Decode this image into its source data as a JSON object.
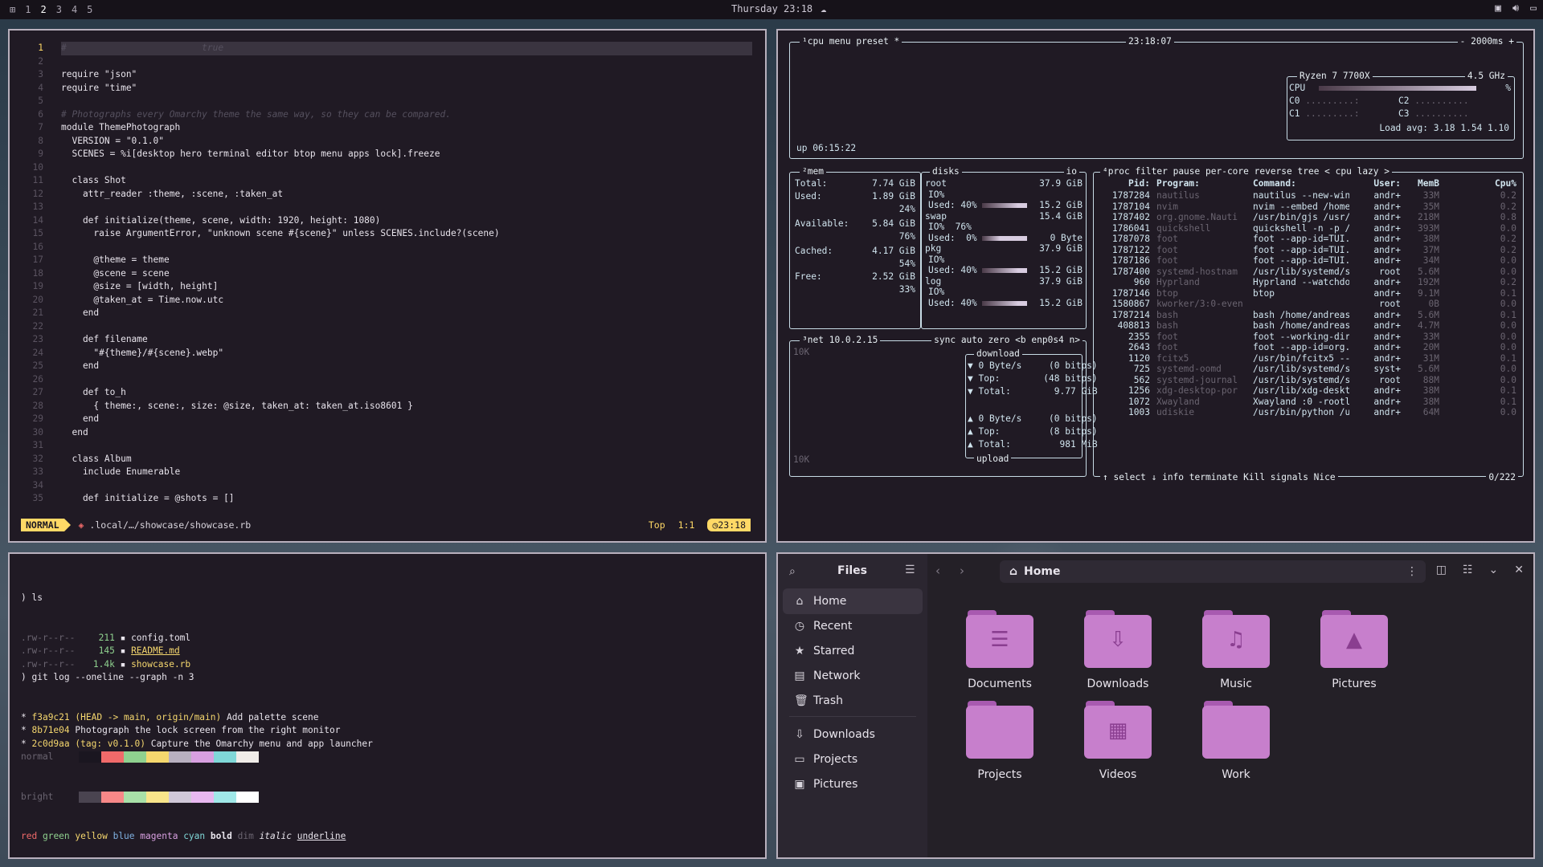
{
  "topbar": {
    "workspaces": [
      "1",
      "2",
      "3",
      "4",
      "5"
    ],
    "active_workspace": "2",
    "clock": "Thursday 23:18",
    "weather_icon": "cloud-icon",
    "tray": [
      "screen-icon",
      "volume-icon",
      "display-icon"
    ]
  },
  "editor": {
    "line_numbers": [
      "1",
      "2",
      "3",
      "4",
      "5",
      "6",
      "7",
      "8",
      "9",
      "10",
      "11",
      "12",
      "13",
      "14",
      "15",
      "16",
      "17",
      "18",
      "19",
      "20",
      "21",
      "22",
      "23",
      "24",
      "25",
      "26",
      "27",
      "28",
      "29",
      "30",
      "31",
      "32",
      "33",
      "34",
      "35"
    ],
    "lines": [
      "#                         true",
      "",
      "require \"json\"",
      "require \"time\"",
      "",
      "# Photographs every Omarchy theme the same way, so they can be compared.",
      "module ThemePhotograph",
      "  VERSION = \"0.1.0\"",
      "  SCENES = %i[desktop hero terminal editor btop menu apps lock].freeze",
      "",
      "  class Shot",
      "    attr_reader :theme, :scene, :taken_at",
      "",
      "    def initialize(theme, scene, width: 1920, height: 1080)",
      "      raise ArgumentError, \"unknown scene #{scene}\" unless SCENES.include?(scene)",
      "",
      "      @theme = theme",
      "      @scene = scene",
      "      @size = [width, height]",
      "      @taken_at = Time.now.utc",
      "    end",
      "",
      "    def filename",
      "      \"#{theme}/#{scene}.webp\"",
      "    end",
      "",
      "    def to_h",
      "      { theme:, scene:, size: @size, taken_at: taken_at.iso8601 }",
      "    end",
      "  end",
      "",
      "  class Album",
      "    include Enumerable",
      "",
      "    def initialize = @shots = []"
    ],
    "mode": "NORMAL",
    "file": ".local/…/showcase/showcase.rb",
    "position_label": "Top",
    "cursor": "1:1",
    "time": "23:18"
  },
  "btop": {
    "cpu_title": "¹cpu",
    "menu": "menu",
    "preset": "preset *",
    "time": "23:18:07",
    "interval": "- 2000ms +",
    "cpu_model": "Ryzen 7 7700X",
    "cpu_freq": "4.5 GHz",
    "cpu_label": "CPU",
    "cores": [
      "C0",
      "C1",
      "C2",
      "C3"
    ],
    "pct": "%",
    "load_avg": "Load avg: 3.18 1.54 1.10",
    "uptime": "up 06:15:22",
    "mem": {
      "title": "²mem",
      "total_label": "Total:",
      "total": "7.74 GiB",
      "used_label": "Used:",
      "used": "1.89 GiB",
      "used_pct": "24%",
      "avail_label": "Available:",
      "avail": "5.84 GiB",
      "avail_pct": "76%",
      "cached_label": "Cached:",
      "cached": "4.17 GiB",
      "cached_pct": "54%",
      "free_label": "Free:",
      "free": "2.52 GiB",
      "free_pct": "33%"
    },
    "disks": {
      "title": "disks",
      "io": "io",
      "rows": [
        {
          "name": "root",
          "size": "37.9 GiB",
          "io": "IO%",
          "used": "Used: 40%",
          "total": "15.2 GiB",
          "pct": 0.4
        },
        {
          "name": "swap",
          "size": "15.4 GiB",
          "io": "IO%  76%",
          "used": "Used:  0%",
          "total": "0 Byte",
          "pct": 0.0
        },
        {
          "name": "pkg",
          "size": "37.9 GiB",
          "io": "IO%",
          "used": "Used: 40%",
          "total": "15.2 GiB",
          "pct": 0.4
        },
        {
          "name": "log",
          "size": "37.9 GiB",
          "io": "IO%",
          "used": "Used: 40%",
          "total": "15.2 GiB",
          "pct": 0.4
        }
      ]
    },
    "net": {
      "title": "³net",
      "ip": "10.0.2.15",
      "opts": "sync auto zero <b enp0s4 n>",
      "scale_top": "10K",
      "scale_bottom": "10K",
      "download": "download",
      "upload": "upload",
      "down_rows": [
        "▼ 0 Byte/s     (0 bitps)",
        "▼ Top:        (48 bitps)",
        "▼ Total:        9.77 GiB"
      ],
      "up_rows": [
        "▲ 0 Byte/s     (0 bitps)",
        "▲ Top:         (8 bitps)",
        "▲ Total:         981 MiB"
      ]
    },
    "proc": {
      "title": "⁴proc",
      "tabs": "filter        pause per-core reverse tree < cpu lazy >",
      "header": [
        "Pid:",
        "Program:",
        "Command:",
        "User:",
        "MemB",
        "Cpu%"
      ],
      "rows": [
        [
          "1787284",
          "nautilus",
          "nautilus --new-win",
          "andr+",
          "33M",
          "0.2"
        ],
        [
          "1787104",
          "nvim",
          "nvim --embed /home",
          "andr+",
          "35M",
          "0.2"
        ],
        [
          "1787402",
          "org.gnome.Nauti",
          "/usr/bin/gjs /usr/",
          "andr+",
          "218M",
          "0.8"
        ],
        [
          "1786041",
          "quickshell",
          "quickshell -n -p /",
          "andr+",
          "393M",
          "0.0"
        ],
        [
          "1787078",
          "foot",
          "foot --app-id=TUI.",
          "andr+",
          "38M",
          "0.2"
        ],
        [
          "1787122",
          "foot",
          "foot --app-id=TUI.",
          "andr+",
          "37M",
          "0.2"
        ],
        [
          "1787186",
          "foot",
          "foot --app-id=TUI.",
          "andr+",
          "34M",
          "0.0"
        ],
        [
          "1787400",
          "systemd-hostnam",
          "/usr/lib/systemd/s",
          "root",
          "5.6M",
          "0.0"
        ],
        [
          "960",
          "Hyprland",
          "Hyprland --watchdo",
          "andr+",
          "192M",
          "0.2"
        ],
        [
          "1787146",
          "btop",
          "btop",
          "andr+",
          "9.1M",
          "0.1"
        ],
        [
          "1580867",
          "kworker/3:0-even",
          "",
          "root",
          "0B",
          "0.0"
        ],
        [
          "1787214",
          "bash",
          "bash /home/andreas",
          "andr+",
          "5.6M",
          "0.1"
        ],
        [
          "408813",
          "bash",
          "bash /home/andreas",
          "andr+",
          "4.7M",
          "0.0"
        ],
        [
          "2355",
          "foot",
          "foot --working-dir",
          "andr+",
          "33M",
          "0.0"
        ],
        [
          "2643",
          "foot",
          "foot --app-id=org.",
          "andr+",
          "20M",
          "0.0"
        ],
        [
          "1120",
          "fcitx5",
          "/usr/bin/fcitx5 --",
          "andr+",
          "31M",
          "0.1"
        ],
        [
          "725",
          "systemd-oomd",
          "/usr/lib/systemd/s",
          "syst+",
          "5.6M",
          "0.0"
        ],
        [
          "562",
          "systemd-journal",
          "/usr/lib/systemd/s",
          "root",
          "88M",
          "0.0"
        ],
        [
          "1256",
          "xdg-desktop-por",
          "/usr/lib/xdg-deskt",
          "andr+",
          "38M",
          "0.1"
        ],
        [
          "1072",
          "Xwayland",
          "Xwayland :0 -rootl",
          "andr+",
          "38M",
          "0.1"
        ],
        [
          "1003",
          "udiskie",
          "/usr/bin/python /u",
          "andr+",
          "64M",
          "0.0"
        ]
      ],
      "footer": "↑ select ↓ info  terminate Kill signals Nice",
      "count": "0/222"
    }
  },
  "terminal": {
    "ls_prompt": ") ls",
    "files": [
      {
        "perm": ".rw-r--r--",
        "size": "211",
        "icon": "toml-icon",
        "name": "config.toml"
      },
      {
        "perm": ".rw-r--r--",
        "size": "145",
        "icon": "markdown-icon",
        "name": "README.md"
      },
      {
        "perm": ".rw-r--r--",
        "size": "1.4k",
        "icon": "ruby-icon",
        "name": "showcase.rb"
      }
    ],
    "git_prompt": ") git log --oneline --graph -n 3",
    "commits": [
      {
        "hash": "f3a9c21",
        "ref": "(HEAD -> main, origin/main)",
        "msg": "Add palette scene"
      },
      {
        "hash": "8b71e04",
        "ref": "",
        "msg": "Photograph the lock screen from the right monitor"
      },
      {
        "hash": "2c0d9aa",
        "ref": "(tag: v0.1.0)",
        "msg": "Capture the Omarchy menu and app launcher"
      }
    ],
    "normal_label": "normal",
    "bright_label": "bright",
    "normal_colors": [
      "#1a1620",
      "#f06a6a",
      "#8fd18f",
      "#f5d76e",
      "#b8b0c0",
      "#d8a0e0",
      "#80d8d8",
      "#f0ece8"
    ],
    "bright_colors": [
      "#4a4450",
      "#f78888",
      "#a8e0a8",
      "#f8e48a",
      "#d0c8d8",
      "#e8b8f0",
      "#a0e8e8",
      "#ffffff"
    ],
    "styles": [
      "red",
      "green",
      "yellow",
      "blue",
      "magenta",
      "cyan",
      "bold",
      "dim",
      "italic",
      "underline"
    ],
    "final_prompt": ")"
  },
  "files": {
    "title": "Files",
    "location": "Home",
    "sidebar": [
      {
        "label": "Home",
        "icon": "home-icon"
      },
      {
        "label": "Recent",
        "icon": "clock-icon"
      },
      {
        "label": "Starred",
        "icon": "star-icon"
      },
      {
        "label": "Network",
        "icon": "network-icon"
      },
      {
        "label": "Trash",
        "icon": "trash-icon"
      },
      {
        "label": "Downloads",
        "icon": "download-icon"
      },
      {
        "label": "Projects",
        "icon": "folder-icon"
      },
      {
        "label": "Pictures",
        "icon": "image-icon"
      }
    ],
    "folders": [
      {
        "label": "Documents",
        "icon": "document-icon"
      },
      {
        "label": "Downloads",
        "icon": "download-icon"
      },
      {
        "label": "Music",
        "icon": "music-icon"
      },
      {
        "label": "Pictures",
        "icon": "image-icon"
      },
      {
        "label": "Projects",
        "icon": "folder-icon"
      },
      {
        "label": "Videos",
        "icon": "film-icon"
      },
      {
        "label": "Work",
        "icon": "folder-icon"
      }
    ]
  }
}
